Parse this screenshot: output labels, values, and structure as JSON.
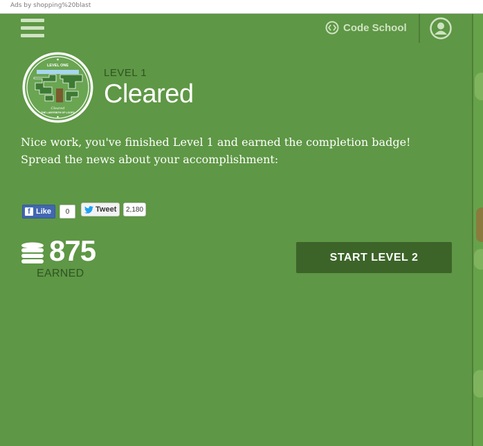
{
  "ad_bar": {
    "text": "Ads by shopping%20blast"
  },
  "header": {
    "brand_label": "Code School",
    "menu_icon": "hamburger-menu-icon",
    "brand_icon": "code-brackets-icon",
    "avatar_icon": "user-avatar-icon"
  },
  "badge": {
    "top_text": "LEVEL ONE",
    "script_text": "Cleared",
    "bottom_text": "THE LABYRINTH OF LOOPS"
  },
  "level": {
    "label": "LEVEL 1",
    "status": "Cleared"
  },
  "message": {
    "line1": "Nice work, you've finished Level 1 and earned the completion badge!",
    "line2": "Spread the news about your accomplishment:"
  },
  "social": {
    "facebook": {
      "label": "Like",
      "count": "0"
    },
    "twitter": {
      "label": "Tweet",
      "count": "2,180"
    }
  },
  "points": {
    "value": "875",
    "label": "EARNED",
    "icon": "coin-stack-icon"
  },
  "actions": {
    "next_label": "START LEVEL 2"
  },
  "colors": {
    "background": "#5e9745",
    "dark_green": "#3c6429",
    "label_green": "#2f5322",
    "light": "#cfe3c2"
  }
}
